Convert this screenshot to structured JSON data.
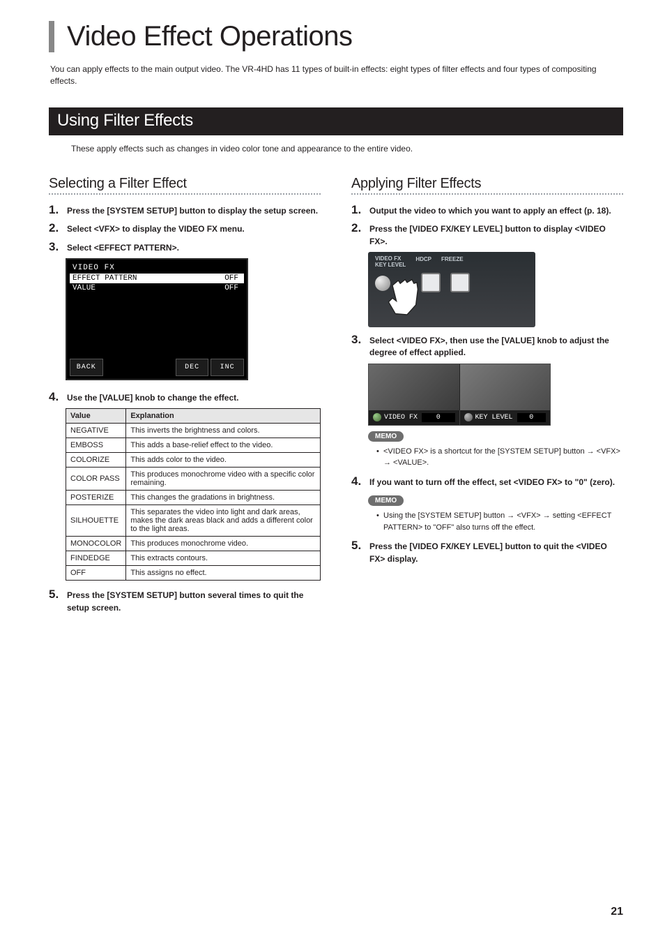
{
  "title": "Video Effect Operations",
  "intro": "You can apply effects to the main output video. The VR-4HD has 11 types of built-in effects: eight types of filter effects and four types of compositing effects.",
  "bar_using": "Using Filter Effects",
  "using_intro": "These apply effects such as changes in video color tone and appearance to the entire video.",
  "left": {
    "heading": "Selecting a Filter Effect",
    "s1": "Press the [SYSTEM SETUP] button to display the setup screen.",
    "s2": "Select <VFX> to display the VIDEO FX menu.",
    "s3": "Select <EFFECT PATTERN>.",
    "menu": {
      "title": "VIDEO FX",
      "r1a": "EFFECT PATTERN",
      "r1b": "OFF",
      "r2a": "VALUE",
      "r2b": "OFF",
      "b1": "BACK",
      "b2": "DEC",
      "b3": "INC"
    },
    "s4": "Use the [VALUE] knob to change the effect.",
    "th_value": "Value",
    "th_exp": "Explanation",
    "rows": [
      {
        "v": "NEGATIVE",
        "e": "This inverts the brightness and colors."
      },
      {
        "v": "EMBOSS",
        "e": "This adds a base-relief effect to the video."
      },
      {
        "v": "COLORIZE",
        "e": "This adds color to the video."
      },
      {
        "v": "COLOR PASS",
        "e": "This produces monochrome video with a specific color remaining."
      },
      {
        "v": "POSTERIZE",
        "e": "This changes the gradations in brightness."
      },
      {
        "v": "SILHOUETTE",
        "e": "This separates the video into light and dark areas, makes the dark areas black and adds a different color to the light areas."
      },
      {
        "v": "MONOCOLOR",
        "e": "This produces monochrome video."
      },
      {
        "v": "FINDEDGE",
        "e": "This extracts contours."
      },
      {
        "v": "OFF",
        "e": "This assigns no effect."
      }
    ],
    "s5": "Press the [SYSTEM SETUP] button several times to quit the setup screen."
  },
  "right": {
    "heading": "Applying Filter Effects",
    "s1": "Output the video to which you want to apply an effect (p. 18).",
    "s2": "Press the [VIDEO FX/KEY LEVEL] button to display <VIDEO FX>.",
    "panel": {
      "l1": "VIDEO FX\nKEY LEVEL",
      "l2": "HDCP",
      "l3": "FREEZE"
    },
    "s3": "Select <VIDEO FX>, then use the [VALUE] knob to adjust the degree of effect applied.",
    "vs": {
      "a": "VIDEO FX",
      "av": "0",
      "b": "KEY LEVEL",
      "bv": "0"
    },
    "memo1_lbl": "MEMO",
    "memo1": "<VIDEO FX> is a shortcut for the [SYSTEM SETUP] button → <VFX> → <VALUE>.",
    "s4": "If you want to turn off the effect, set <VIDEO FX> to \"0\" (zero).",
    "memo2_lbl": "MEMO",
    "memo2": "Using the [SYSTEM SETUP] button → <VFX> → setting <EFFECT PATTERN> to \"OFF\" also turns off the effect.",
    "s5": "Press the [VIDEO FX/KEY LEVEL] button to quit the <VIDEO FX> display."
  },
  "page_number": "21"
}
